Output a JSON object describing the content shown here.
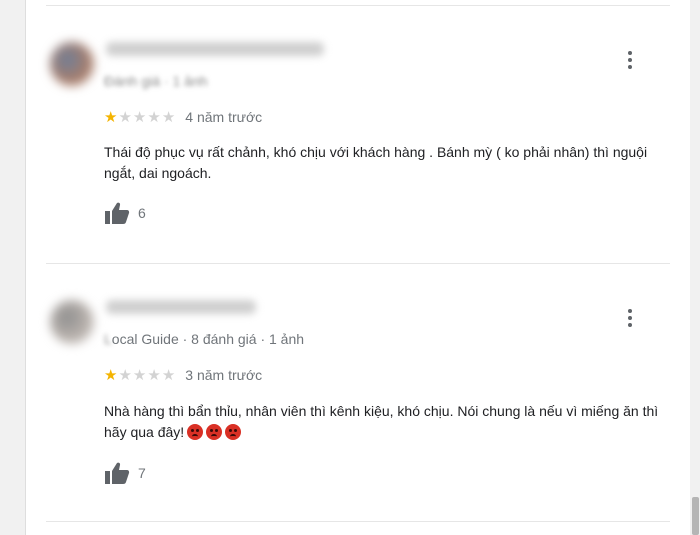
{
  "reviews": [
    {
      "meta_blurred": "Đánh giá · 1 ảnh",
      "meta_visible": "",
      "stars_filled": 1,
      "stars_total": 5,
      "time": "4 năm trước",
      "text": "Thái độ phục vụ rất chảnh, khó chịu với khách hàng . Bánh mỳ ( ko phải nhân) thì nguội ngắt, dai ngoách.",
      "likes": "6"
    },
    {
      "meta_blurred": "L",
      "meta_visible": "ocal Guide · 8 đánh giá · 1 ảnh",
      "stars_filled": 1,
      "stars_total": 5,
      "time": "3 năm trước",
      "text": "Nhà hàng thì bẩn thỉu, nhân viên thì kênh kiệu, khó chịu. Nói chung là nếu vì miếng ăn thì hãy qua đây!",
      "emojis": 3,
      "likes": "7"
    }
  ],
  "colors": {
    "star_filled": "#f4b400",
    "star_empty": "#d3d3d3",
    "emoji": "#d93025"
  },
  "icons": {
    "more": "more-vert-icon",
    "like": "thumbs-up-icon",
    "star": "star-icon",
    "emoji": "angry-face-icon"
  }
}
